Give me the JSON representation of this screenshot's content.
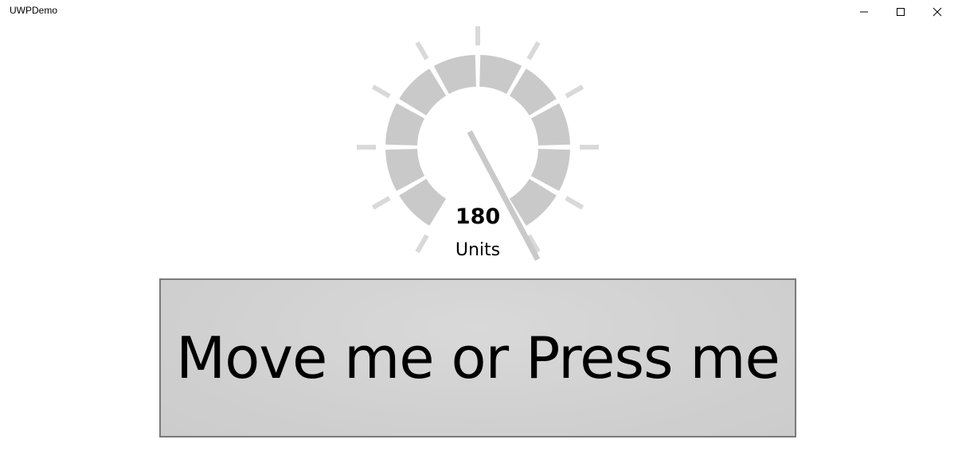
{
  "window": {
    "title": "UWPDemo",
    "controls": [
      "minimize",
      "maximize",
      "close"
    ]
  },
  "gauge": {
    "value": "180",
    "unit": "Units",
    "needle_value": 180,
    "colors": {
      "scale": "#c9c9c9",
      "ticks": "#d9d9d9",
      "needle": "#c9c9c9"
    }
  },
  "action_button": {
    "label": "Move me or Press me",
    "background": "#d3d3d3",
    "border": "#7a7a7a"
  }
}
